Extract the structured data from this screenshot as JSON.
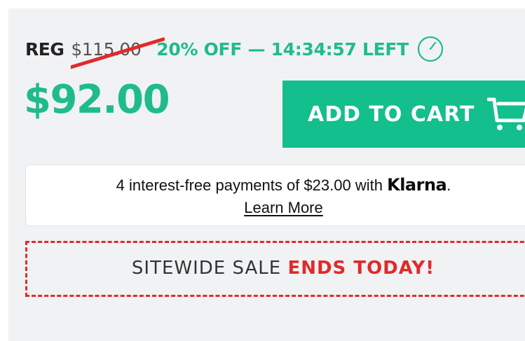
{
  "pricing": {
    "reg_label": "REG",
    "reg_price": "$115.00",
    "discount_text": "20% OFF — 14:34:57 LEFT",
    "sale_price": "$92.00"
  },
  "cart_button": {
    "label": "ADD TO CART",
    "icon": "shopping-cart-icon"
  },
  "klarna": {
    "text": "4 interest-free payments of $23.00 with",
    "brand": "Klarna",
    "suffix": ".",
    "learn_more": "Learn More"
  },
  "sale_banner": {
    "prefix": "SITEWIDE SALE",
    "emphasis": "ENDS TODAY!"
  },
  "colors": {
    "accent_green": "#12bf8d",
    "sale_red": "#e12a2a",
    "panel_bg": "#f1f2f4"
  }
}
